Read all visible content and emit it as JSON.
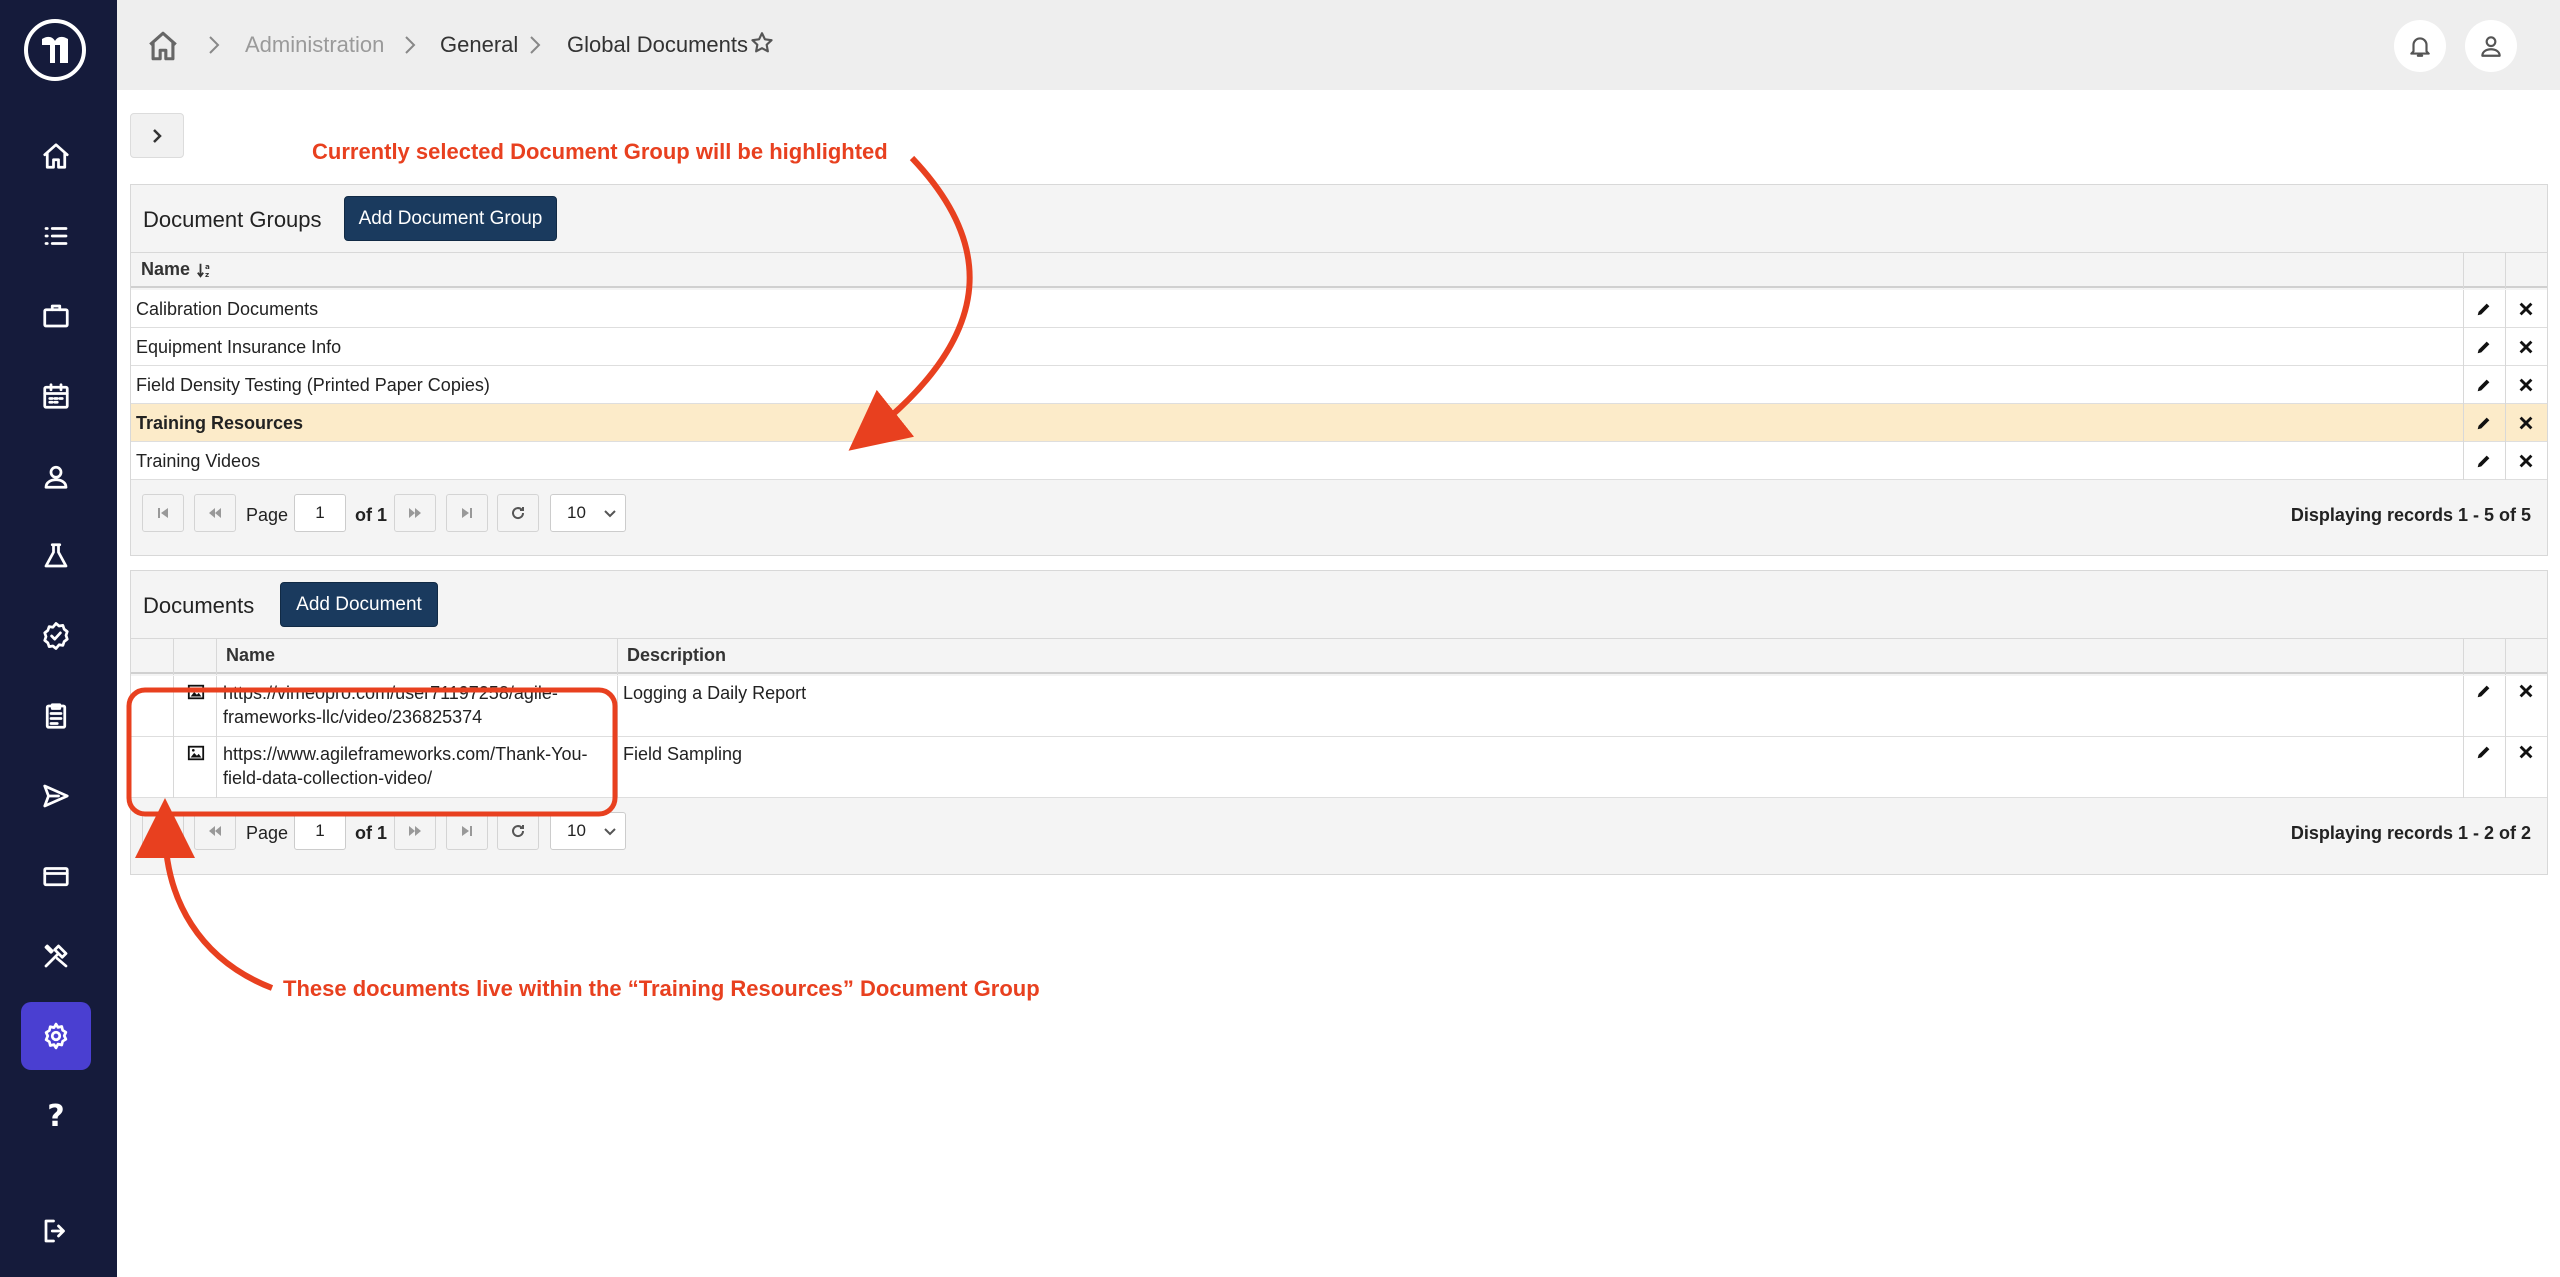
{
  "sidebar": {
    "items": [
      {
        "icon": "home-icon"
      },
      {
        "icon": "list-icon"
      },
      {
        "icon": "briefcase-icon"
      },
      {
        "icon": "calendar-icon"
      },
      {
        "icon": "user-icon"
      },
      {
        "icon": "flask-icon"
      },
      {
        "icon": "badge-check-icon"
      },
      {
        "icon": "clipboard-icon"
      },
      {
        "icon": "send-icon"
      },
      {
        "icon": "credit-card-icon"
      },
      {
        "icon": "tools-icon"
      },
      {
        "icon": "gear-icon",
        "active": true
      },
      {
        "icon": "help-icon"
      },
      {
        "icon": "logout-icon"
      }
    ],
    "help_glyph": "?"
  },
  "breadcrumb": {
    "items": [
      "Administration",
      "General",
      "Global Documents"
    ]
  },
  "groups_panel": {
    "title": "Document Groups",
    "add_button": "Add Document Group",
    "columns": [
      "Name"
    ],
    "rows": [
      {
        "name": "Calibration Documents",
        "selected": false
      },
      {
        "name": "Equipment Insurance Info",
        "selected": false
      },
      {
        "name": "Field Density Testing (Printed Paper Copies)",
        "selected": false
      },
      {
        "name": "Training Resources",
        "selected": true
      },
      {
        "name": "Training Videos",
        "selected": false
      }
    ],
    "pager": {
      "page_label": "Page",
      "page_value": "1",
      "of_label": "of",
      "total_pages": "1",
      "page_size": "10",
      "records": "Displaying records 1 - 5 of 5"
    }
  },
  "documents_panel": {
    "title": "Documents",
    "add_button": "Add Document",
    "columns": [
      "Name",
      "Description"
    ],
    "rows": [
      {
        "name_line1": "https://vimeopro.com/user71197258/agile-",
        "name_line2": "frameworks-llc/video/236825374",
        "description": "Logging a Daily Report"
      },
      {
        "name_line1": "https://www.agileframeworks.com/Thank-You-",
        "name_line2": "field-data-collection-video/",
        "description": "Field Sampling"
      }
    ],
    "pager": {
      "page_label": "Page",
      "page_value": "1",
      "of_label": "of",
      "total_pages": "1",
      "page_size": "10",
      "records": "Displaying records 1 - 2 of 2"
    }
  },
  "annotations": {
    "top": "Currently selected Document Group will be highlighted",
    "bottom": "These documents live within the “Training Resources” Document Group"
  },
  "colors": {
    "sidebar_bg": "#151b3b",
    "active_nav": "#4a3fd1",
    "primary_button": "#1a3a5e",
    "highlight_row": "#fcebc9",
    "annotation": "#e8401f"
  }
}
